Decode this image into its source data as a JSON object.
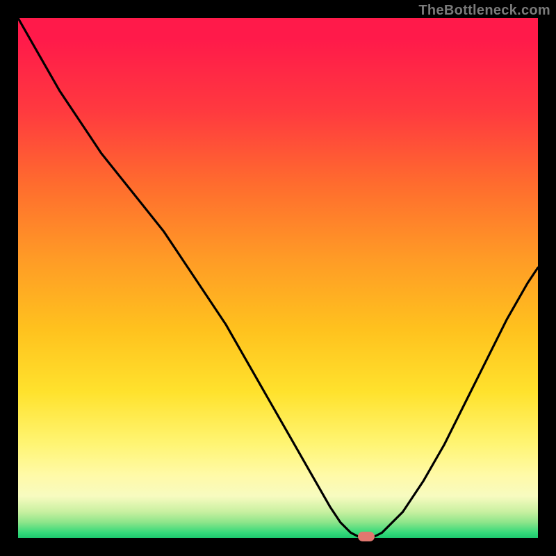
{
  "watermark": "TheBottleneck.com",
  "colors": {
    "frame": "#000000",
    "gradient_top": "#ff1a4a",
    "gradient_bottom": "#1dc86e",
    "curve": "#000000",
    "marker": "#e0776f"
  },
  "chart_data": {
    "type": "line",
    "title": "",
    "xlabel": "",
    "ylabel": "",
    "xlim": [
      0,
      100
    ],
    "ylim": [
      0,
      100
    ],
    "grid": false,
    "legend": false,
    "series": [
      {
        "name": "bottleneck-curve",
        "x": [
          0,
          4,
          8,
          12,
          16,
          20,
          24,
          28,
          32,
          36,
          40,
          44,
          48,
          52,
          56,
          60,
          62,
          64,
          66,
          68,
          70,
          74,
          78,
          82,
          86,
          90,
          94,
          98,
          100
        ],
        "y": [
          100,
          93,
          86,
          80,
          74,
          69,
          64,
          59,
          53,
          47,
          41,
          34,
          27,
          20,
          13,
          6,
          3,
          1,
          0,
          0,
          1,
          5,
          11,
          18,
          26,
          34,
          42,
          49,
          52
        ]
      }
    ],
    "marker": {
      "x": 67,
      "y": 0
    },
    "background": "vertical-gradient-red-to-green"
  }
}
